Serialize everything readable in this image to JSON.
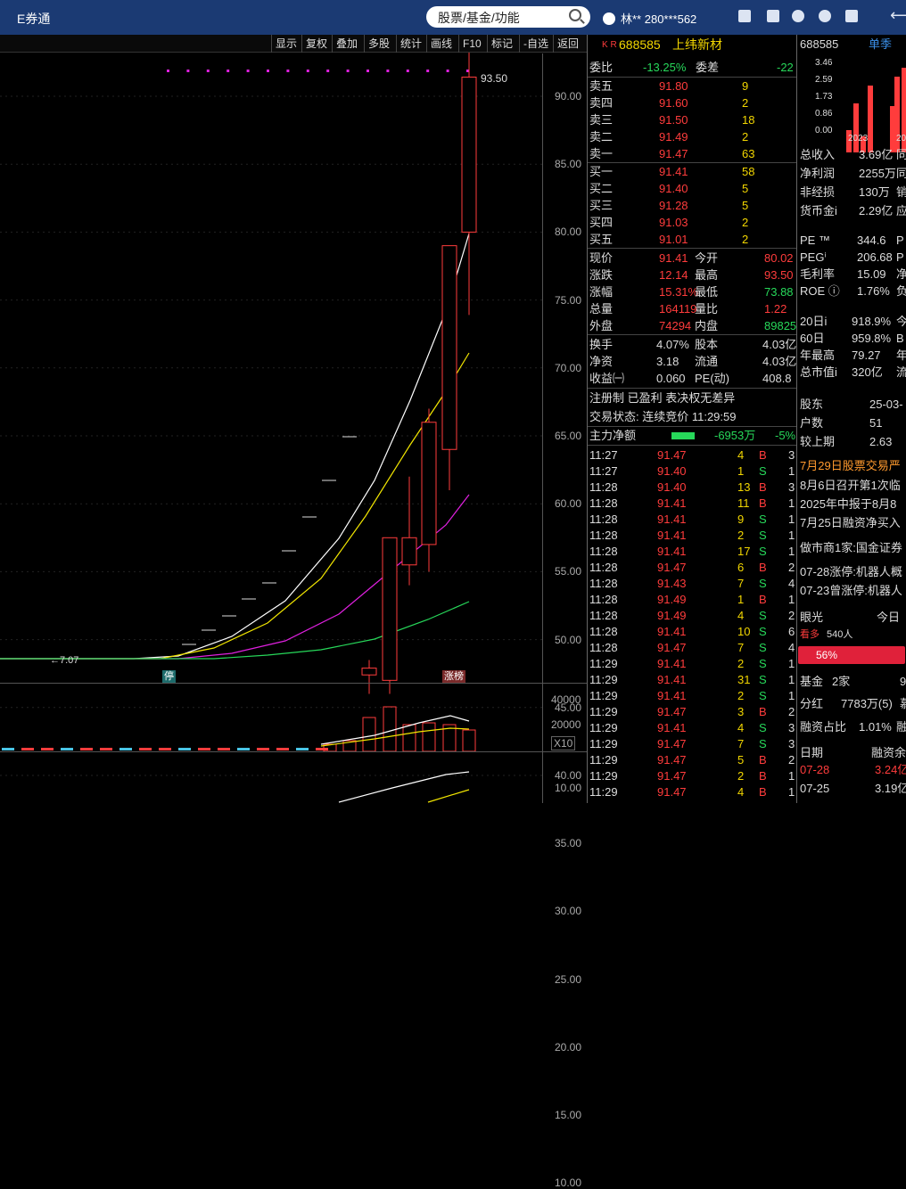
{
  "app": {
    "title": "E券通",
    "search_placeholder": "股票/基金/功能",
    "user": "林**  280***562"
  },
  "toolbar": [
    "显示",
    "复权",
    "叠加",
    "多股",
    "统计",
    "画线",
    "F10",
    "标记",
    "-自选",
    "返回"
  ],
  "price_axis": [
    "90.00",
    "85.00",
    "80.00",
    "75.00",
    "70.00",
    "65.00",
    "60.00",
    "55.00",
    "50.00",
    "45.00",
    "40.00",
    "35.00",
    "30.00",
    "25.00",
    "20.00",
    "15.00",
    "10.00"
  ],
  "vol_axis": [
    "40000",
    "20000",
    "X10"
  ],
  "vol_axis2": "10.00",
  "chart_labels": {
    "high": "93.50",
    "low": "7.07",
    "tag_stop": "停",
    "tag_limit": "涨榜"
  },
  "chart_data": {
    "type": "candlestick",
    "series": [
      {
        "o": 47.4,
        "h": 48.5,
        "l": 46.0,
        "c": 47.9
      },
      {
        "o": 47.0,
        "h": 57.5,
        "l": 46.0,
        "c": 57.5
      },
      {
        "o": 55.5,
        "h": 62.0,
        "l": 54.0,
        "c": 57.5
      },
      {
        "o": 57.0,
        "h": 67.0,
        "l": 55.0,
        "c": 66.0
      },
      {
        "o": 64.0,
        "h": 79.0,
        "l": 61.0,
        "c": 79.0
      },
      {
        "o": 80.0,
        "h": 93.5,
        "l": 73.9,
        "c": 91.41
      }
    ]
  },
  "quote": {
    "code": "688585",
    "name": "上纬新材",
    "badge": "K R",
    "wb_label": "委比",
    "wb": "-13.25%",
    "wc_label": "委差",
    "wc": "-22",
    "asks": [
      [
        "卖五",
        "91.80",
        "9"
      ],
      [
        "卖四",
        "91.60",
        "2"
      ],
      [
        "卖三",
        "91.50",
        "18"
      ],
      [
        "卖二",
        "91.49",
        "2"
      ],
      [
        "卖一",
        "91.47",
        "63"
      ]
    ],
    "bids": [
      [
        "买一",
        "91.41",
        "58"
      ],
      [
        "买二",
        "91.40",
        "5"
      ],
      [
        "买三",
        "91.28",
        "5"
      ],
      [
        "买四",
        "91.03",
        "2"
      ],
      [
        "买五",
        "91.01",
        "2"
      ]
    ],
    "stats": [
      [
        "现价",
        "91.41",
        "今开",
        "80.02"
      ],
      [
        "涨跌",
        "12.14",
        "最高",
        "93.50"
      ],
      [
        "涨幅",
        "15.31%",
        "最低",
        "73.88"
      ],
      [
        "总量",
        "164119",
        "量比",
        "1.22"
      ],
      [
        "外盘",
        "74294",
        "内盘",
        "89825"
      ]
    ],
    "stats2": [
      [
        "换手",
        "4.07%",
        "股本",
        "4.03亿"
      ],
      [
        "净资",
        "3.18",
        "流通",
        "4.03亿"
      ],
      [
        "收益㈠",
        "0.060",
        "PE(动)",
        "408.8"
      ]
    ],
    "notes": "注册制 已盈利 表决权无差异",
    "status": "交易状态: 连续竞价 11:29:59",
    "flow_label": "主力净额",
    "flow": "-6953万",
    "flow_pct": "-5%"
  },
  "ticks": [
    [
      "11:27",
      "91.47",
      "4",
      "B"
    ],
    [
      "11:27",
      "91.40",
      "1",
      "S"
    ],
    [
      "11:28",
      "91.40",
      "13",
      "B"
    ],
    [
      "11:28",
      "91.41",
      "11",
      "B"
    ],
    [
      "11:28",
      "91.41",
      "9",
      "S"
    ],
    [
      "11:28",
      "91.41",
      "2",
      "S"
    ],
    [
      "11:28",
      "91.41",
      "17",
      "S"
    ],
    [
      "11:28",
      "91.47",
      "6",
      "B"
    ],
    [
      "11:28",
      "91.43",
      "7",
      "S"
    ],
    [
      "11:28",
      "91.49",
      "1",
      "B"
    ],
    [
      "11:28",
      "91.49",
      "4",
      "S"
    ],
    [
      "11:28",
      "91.41",
      "10",
      "S"
    ],
    [
      "11:28",
      "91.47",
      "7",
      "S"
    ],
    [
      "11:29",
      "91.41",
      "2",
      "S"
    ],
    [
      "11:29",
      "91.41",
      "31",
      "S"
    ],
    [
      "11:29",
      "91.41",
      "2",
      "S"
    ],
    [
      "11:29",
      "91.47",
      "3",
      "B"
    ],
    [
      "11:29",
      "91.41",
      "4",
      "S"
    ],
    [
      "11:29",
      "91.47",
      "7",
      "S"
    ],
    [
      "11:29",
      "91.47",
      "5",
      "B"
    ],
    [
      "11:29",
      "91.47",
      "2",
      "B"
    ],
    [
      "11:29",
      "91.47",
      "4",
      "B"
    ]
  ],
  "tick_tail": [
    "3",
    "1",
    "3",
    "1",
    "1",
    "1",
    "1",
    "2",
    "4",
    "1",
    "2",
    "6",
    "4",
    "1",
    "1",
    "1",
    "2",
    "3",
    "3",
    "2",
    "1",
    "1"
  ],
  "fin": {
    "code": "688585",
    "period": "单季",
    "yaxis": [
      "3.46",
      "2.59",
      "1.73",
      "0.86",
      "0.00"
    ],
    "year": "2023",
    "year2": "20",
    "rows": [
      [
        "总收入",
        "3.69亿",
        "同"
      ],
      [
        "净利润",
        "2255万",
        "同"
      ],
      [
        "非经损",
        "130万",
        "销"
      ],
      [
        "货币金i",
        "2.29亿",
        "应"
      ]
    ],
    "rows2": [
      [
        "PE ™",
        "344.6",
        "P"
      ],
      [
        "PEGⁱ",
        "206.68",
        "P"
      ],
      [
        "毛利率",
        "15.09",
        "净"
      ],
      [
        "ROE ⓘ",
        "1.76%",
        "负"
      ]
    ],
    "rows3": [
      [
        "20日i",
        "918.9%",
        "今"
      ],
      [
        "60日",
        "959.8%",
        "B"
      ],
      [
        "年最高",
        "79.27",
        "年"
      ],
      [
        "总市值i",
        "320亿",
        "流"
      ]
    ],
    "rows4": [
      [
        "股东",
        "25-03-",
        ""
      ],
      [
        "户数",
        "51",
        ""
      ],
      [
        "较上期",
        "2.63",
        ""
      ]
    ],
    "news": [
      "7月29日股票交易严",
      "8月6日召开第1次临",
      "2025年中报于8月8",
      "7月25日融资净买入"
    ],
    "maker": "做市商1家:国金证券",
    "limits": [
      "07-28涨停:机器人概",
      "07-23曾涨停:机器人"
    ],
    "eye": "眼光",
    "today": "今日",
    "bull": "看多",
    "bull_count": "540人",
    "bull_pct": "56%",
    "fund": "基金",
    "fund_n": "2家",
    "fund_v": "9",
    "div": "分红",
    "div_v": "7783万(5)",
    "div_t": "慕",
    "margin": "融资占比",
    "margin_v": "1.01%",
    "margin_t": "融",
    "date_h": "日期",
    "bal_h": "融资余",
    "dates": [
      [
        "07-28",
        "3.24亿"
      ],
      [
        "07-25",
        "3.19亿"
      ]
    ]
  }
}
